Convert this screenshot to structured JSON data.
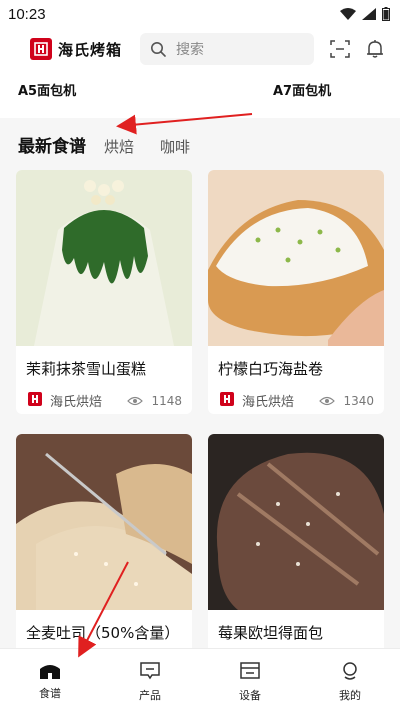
{
  "status_bar": {
    "time": "10:23"
  },
  "header": {
    "logo_text": "海氏烤箱",
    "search_placeholder": "搜索"
  },
  "devices": {
    "items": [
      {
        "name": "A5面包机"
      },
      {
        "name": "A7面包机"
      }
    ]
  },
  "recipes": {
    "tabs": [
      {
        "label": "最新食谱"
      },
      {
        "label": "烘焙"
      },
      {
        "label": "咖啡"
      }
    ],
    "cards": [
      {
        "title": "茉莉抹茶雪山蛋糕",
        "author": "海氏烘焙",
        "views": "1148"
      },
      {
        "title": "柠檬白巧海盐卷",
        "author": "海氏烘焙",
        "views": "1340"
      },
      {
        "title": "全麦吐司（50%含量）",
        "author": "",
        "views": ""
      },
      {
        "title": "莓果欧坦得面包",
        "author": "",
        "views": ""
      }
    ]
  },
  "bottom_nav": {
    "items": [
      {
        "label": "食谱"
      },
      {
        "label": "产品"
      },
      {
        "label": "设备"
      },
      {
        "label": "我的"
      }
    ]
  },
  "colors": {
    "brand": "#d0021b",
    "annotation_arrow": "#e02020"
  }
}
